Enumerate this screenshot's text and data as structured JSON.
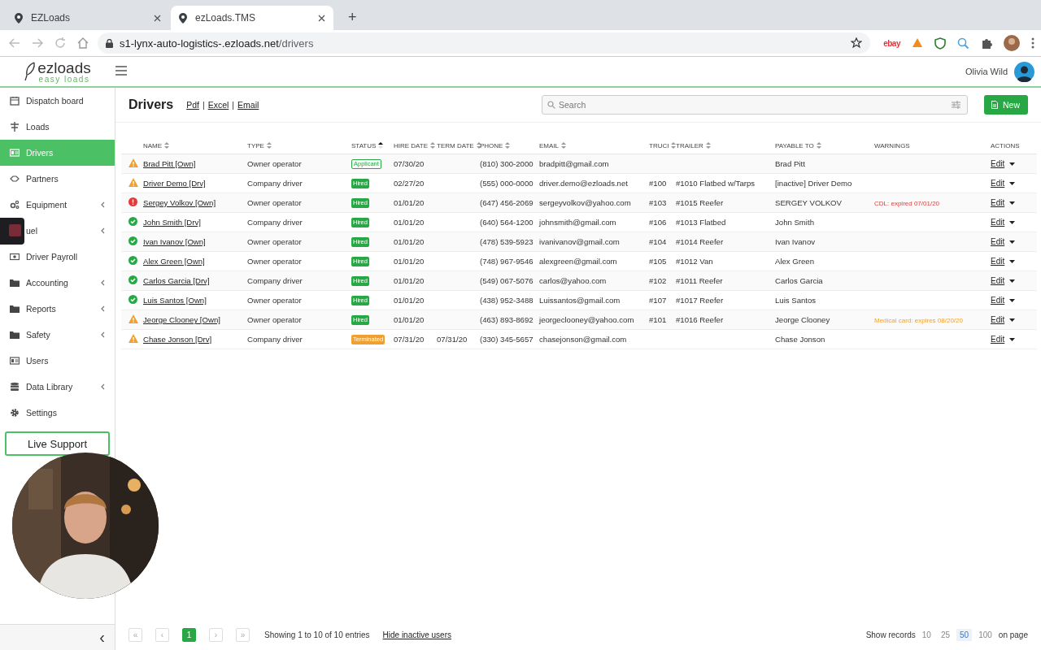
{
  "browser": {
    "tabs": [
      {
        "title": "EZLoads",
        "selected": false
      },
      {
        "title": "ezLoads.TMS",
        "selected": true
      }
    ],
    "new_tab": "+",
    "address": {
      "host": "s1-lynx-auto-logistics-.ezloads.net",
      "path": "/drivers"
    },
    "extension_logo": "ebay"
  },
  "header": {
    "logo": {
      "name": "ezloads",
      "tagline": "easy loads"
    },
    "user": "Olivia Wild"
  },
  "sidebar": {
    "items": [
      {
        "label": "Dispatch board",
        "kind": "calendar",
        "expandable": false,
        "selected": false
      },
      {
        "label": "Loads",
        "kind": "signpost",
        "expandable": false,
        "selected": false
      },
      {
        "label": "Drivers",
        "kind": "idcard",
        "expandable": false,
        "selected": true
      },
      {
        "label": "Partners",
        "kind": "handshake",
        "expandable": false,
        "selected": false
      },
      {
        "label": "Equipment",
        "kind": "gears",
        "expandable": true,
        "selected": false
      },
      {
        "label": "uel",
        "kind": "covered",
        "expandable": true,
        "selected": false
      },
      {
        "label": "Driver Payroll",
        "kind": "money",
        "expandable": false,
        "selected": false
      },
      {
        "label": "Accounting",
        "kind": "folder",
        "expandable": true,
        "selected": false
      },
      {
        "label": "Reports",
        "kind": "folder",
        "expandable": true,
        "selected": false
      },
      {
        "label": "Safety",
        "kind": "folder",
        "expandable": true,
        "selected": false
      },
      {
        "label": "Users",
        "kind": "idcard",
        "expandable": false,
        "selected": false
      },
      {
        "label": "Data Library",
        "kind": "database",
        "expandable": true,
        "selected": false
      },
      {
        "label": "Settings",
        "kind": "gear",
        "expandable": false,
        "selected": false
      }
    ],
    "live_support": "Live Support",
    "collapse": "‹"
  },
  "page": {
    "title": "Drivers",
    "export_links": [
      "Pdf",
      "Excel",
      "Email"
    ],
    "link_separator": "|",
    "search": {
      "placeholder": "Search"
    },
    "new_button": "New"
  },
  "table": {
    "columns": [
      {
        "label": "NAME",
        "sortable": true,
        "sorted": false
      },
      {
        "label": "TYPE",
        "sortable": true,
        "sorted": false
      },
      {
        "label": "STATUS",
        "sortable": true,
        "sorted": true
      },
      {
        "label": "HIRE DATE",
        "sortable": true,
        "sorted": false
      },
      {
        "label": "TERM DATE",
        "sortable": true,
        "sorted": false
      },
      {
        "label": "PHONE",
        "sortable": true,
        "sorted": false
      },
      {
        "label": "EMAIL",
        "sortable": true,
        "sorted": false
      },
      {
        "label": "TRUCI",
        "sortable": true,
        "sorted": false
      },
      {
        "label": "TRAILER",
        "sortable": true,
        "sorted": false
      },
      {
        "label": "PAYABLE TO",
        "sortable": true,
        "sorted": false
      },
      {
        "label": "WARNINGS",
        "sortable": false
      },
      {
        "label": "ACTIONS",
        "sortable": false
      }
    ],
    "rows": [
      {
        "kind": "warning",
        "name": "Brad Pitt [Own]",
        "type": "Owner operator",
        "status": {
          "label": "Applicant",
          "kind": "applicant"
        },
        "hire_date": "07/30/20",
        "phone": "(810) 300-2000",
        "email": "bradpitt@gmail.com",
        "payable_to": "Brad Pitt",
        "action": "Edit"
      },
      {
        "kind": "warning",
        "name": "Driver Demo [Drv]",
        "type": "Company driver",
        "status": {
          "label": "Hired",
          "kind": "hired"
        },
        "hire_date": "02/27/20",
        "phone": "(555) 000-0000",
        "email": "driver.demo@ezloads.net",
        "truck": "#100",
        "trailer": "#1010 Flatbed w/Tarps",
        "payable_to": "[inactive] Driver Demo",
        "action": "Edit"
      },
      {
        "kind": "error",
        "name": "Sergey Volkov [Own]",
        "type": "Owner operator",
        "status": {
          "label": "Hired",
          "kind": "hired"
        },
        "hire_date": "01/01/20",
        "phone": "(647) 456-2069",
        "email": "sergeyvolkov@yahoo.com",
        "truck": "#103",
        "trailer": "#1015 Reefer",
        "payable_to": "SERGEY VOLKOV",
        "warning": {
          "text": "CDL: expired 07/01/20",
          "kind": "error"
        },
        "action": "Edit"
      },
      {
        "kind": "ok",
        "name": "John Smith [Drv]",
        "type": "Company driver",
        "status": {
          "label": "Hired",
          "kind": "hired"
        },
        "hire_date": "01/01/20",
        "phone": "(640) 564-1200",
        "email": "johnsmith@gmail.com",
        "truck": "#106",
        "trailer": "#1013 Flatbed",
        "payable_to": "John Smith",
        "action": "Edit"
      },
      {
        "kind": "ok",
        "name": "Ivan Ivanov [Own]",
        "type": "Owner operator",
        "status": {
          "label": "Hired",
          "kind": "hired"
        },
        "hire_date": "01/01/20",
        "phone": "(478) 539-5923",
        "email": "ivanivanov@gmail.com",
        "truck": "#104",
        "trailer": "#1014 Reefer",
        "payable_to": "Ivan Ivanov",
        "action": "Edit"
      },
      {
        "kind": "ok",
        "name": "Alex Green [Own]",
        "type": "Owner operator",
        "status": {
          "label": "Hired",
          "kind": "hired"
        },
        "hire_date": "01/01/20",
        "phone": "(748) 967-9546",
        "email": "alexgreen@gmail.com",
        "truck": "#105",
        "trailer": "#1012 Van",
        "payable_to": "Alex Green",
        "action": "Edit"
      },
      {
        "kind": "ok",
        "name": "Carlos Garcia [Drv]",
        "type": "Company driver",
        "status": {
          "label": "Hired",
          "kind": "hired"
        },
        "hire_date": "01/01/20",
        "phone": "(549) 067-5076",
        "email": "carlos@yahoo.com",
        "truck": "#102",
        "trailer": "#1011 Reefer",
        "payable_to": "Carlos Garcia",
        "action": "Edit"
      },
      {
        "kind": "ok",
        "name": "Luis Santos [Own]",
        "type": "Owner operator",
        "status": {
          "label": "Hired",
          "kind": "hired"
        },
        "hire_date": "01/01/20",
        "phone": "(438) 952-3488",
        "email": "Luissantos@gmail.com",
        "truck": "#107",
        "trailer": "#1017 Reefer",
        "payable_to": "Luis Santos",
        "action": "Edit"
      },
      {
        "kind": "warning",
        "name": "Jeorge Clooney [Own]",
        "type": "Owner operator",
        "status": {
          "label": "Hired",
          "kind": "hired"
        },
        "hire_date": "01/01/20",
        "phone": "(463) 893-8692",
        "email": "jeorgeclooney@yahoo.com",
        "truck": "#101",
        "trailer": "#1016 Reefer",
        "payable_to": "Jeorge Clooney",
        "warning": {
          "text": "Medical card: expires 08/20/20",
          "kind": "warning"
        },
        "action": "Edit"
      },
      {
        "kind": "warning",
        "name": "Chase Jonson [Drv]",
        "type": "Company driver",
        "status": {
          "label": "Terminated",
          "kind": "terminated"
        },
        "hire_date": "07/31/20",
        "term_date": "07/31/20",
        "phone": "(330) 345-5657",
        "email": "chasejonson@gmail.com",
        "payable_to": "Chase Jonson",
        "action": "Edit"
      }
    ]
  },
  "footer": {
    "pager": [
      {
        "label": "«",
        "selected": false
      },
      {
        "label": "‹",
        "selected": false
      },
      {
        "label": "1",
        "selected": true
      },
      {
        "label": "›",
        "selected": false
      },
      {
        "label": "»",
        "selected": false
      }
    ],
    "info": "Showing 1 to 10 of 10 entries",
    "hide_link": "Hide inactive users",
    "records_label": "Show records",
    "records_options": [
      {
        "label": "10",
        "selected": false
      },
      {
        "label": "25",
        "selected": false
      },
      {
        "label": "50",
        "selected": true
      },
      {
        "label": "100",
        "selected": false
      }
    ],
    "records_suffix": "on page"
  }
}
